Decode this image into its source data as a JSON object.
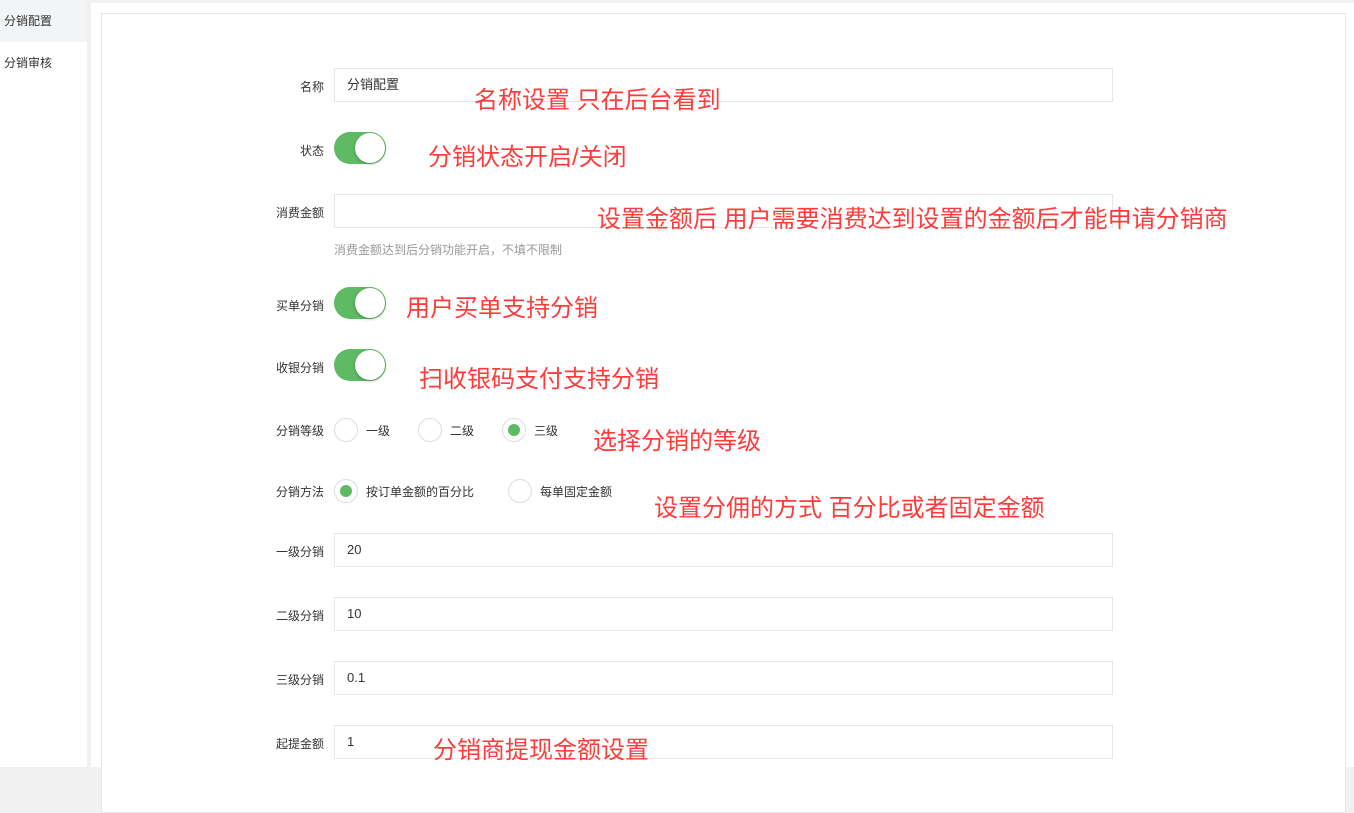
{
  "sidebar": {
    "items": [
      {
        "label": "分销配置",
        "active": true
      },
      {
        "label": "分销审核",
        "active": false
      }
    ]
  },
  "form": {
    "name": {
      "label": "名称",
      "value": "分销配置"
    },
    "status": {
      "label": "状态",
      "on": true
    },
    "amount": {
      "label": "消费金额",
      "value": "",
      "help": "消费金额达到后分销功能开启，不填不限制"
    },
    "buy": {
      "label": "买单分销",
      "on": true
    },
    "cashier": {
      "label": "收银分销",
      "on": true
    },
    "level": {
      "label": "分销等级",
      "options": [
        "一级",
        "二级",
        "三级"
      ],
      "selected": "三级"
    },
    "method": {
      "label": "分销方法",
      "options": [
        "按订单金额的百分比",
        "每单固定金额"
      ],
      "selected": "按订单金额的百分比"
    },
    "level1": {
      "label": "一级分销",
      "value": "20"
    },
    "level2": {
      "label": "二级分销",
      "value": "10"
    },
    "level3": {
      "label": "三级分销",
      "value": "0.1"
    },
    "withdraw": {
      "label": "起提金额",
      "value": "1"
    }
  },
  "annotations": [
    "名称设置 只在后台看到",
    "分销状态开启/关闭",
    "设置金额后 用户需要消费达到设置的金额后才能申请分销商",
    "用户买单支持分销",
    "扫收银码支付支持分销",
    "选择分销的等级",
    "设置分佣的方式 百分比或者固定金额",
    "分销商提现金额设置"
  ],
  "colors": {
    "accent": "#5fbb63",
    "annotation": "#ff3b3b"
  }
}
